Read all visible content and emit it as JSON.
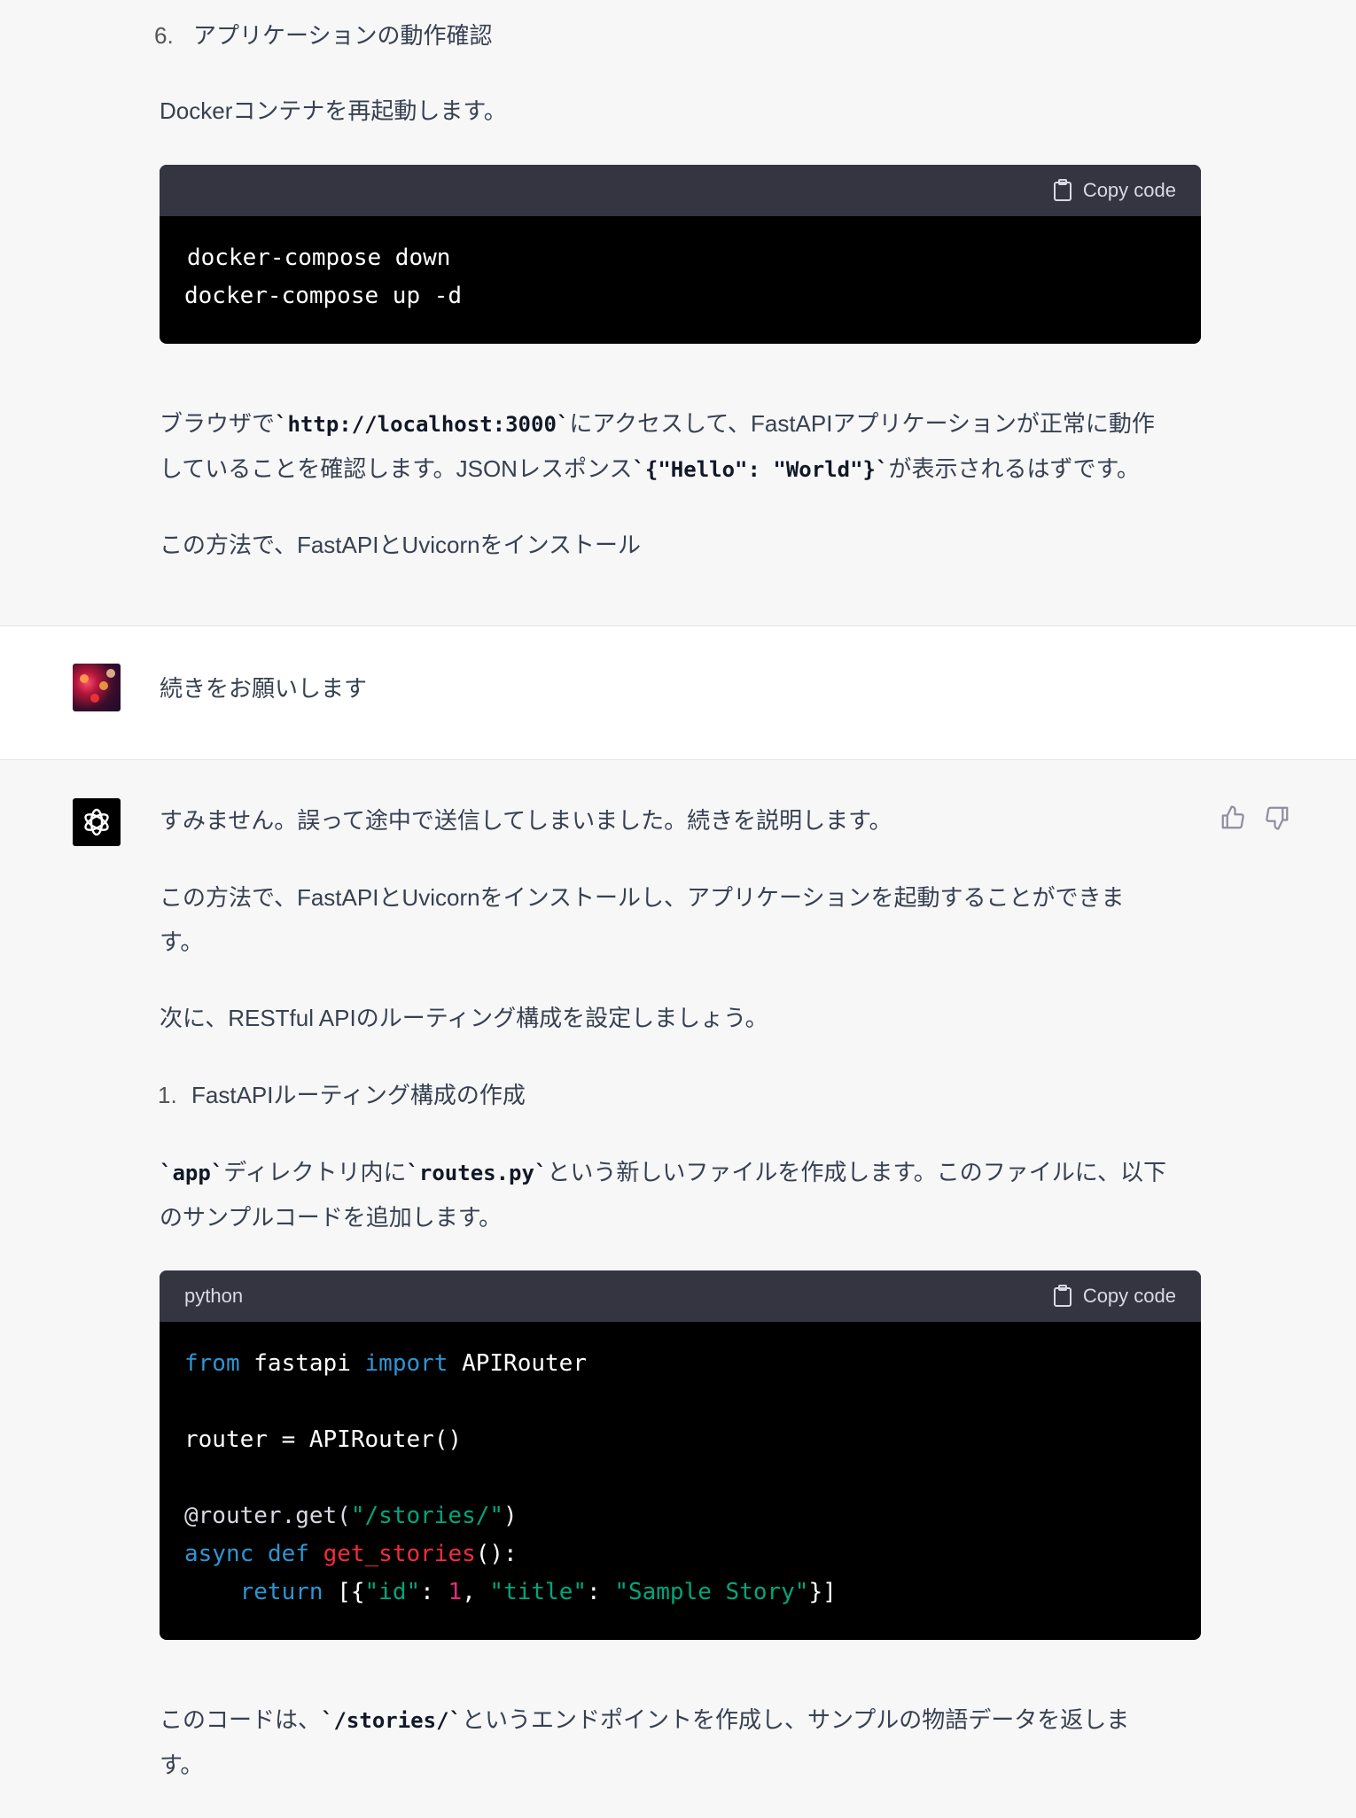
{
  "top_section": {
    "step6_number": "6.",
    "step6_label": "アプリケーションの動作確認",
    "restart_text": "Dockerコンテナを再起動します。",
    "code1": {
      "language": "",
      "copy_label": "Copy code",
      "lines": [
        "docker-compose down",
        "docker-compose up -d"
      ]
    },
    "browser_text_1a": "ブラウザで",
    "browser_code_1": "http://localhost:3000",
    "browser_text_1b": "にアクセスして、FastAPIアプリケーションが正常に動作",
    "browser_text_2a": "していることを確認します。JSONレスポンス",
    "browser_code_2": "{\"Hello\": \"World\"}",
    "browser_text_2b": "が表示されるはずです。",
    "truncated_text": "この方法で、FastAPIとUvicornをインストール"
  },
  "user_message": {
    "text": "続きをお願いします"
  },
  "assistant_message": {
    "apology": "すみません。誤って途中で送信してしまいました。続きを説明します。",
    "install_line1": "この方法で、FastAPIとUvicornをインストールし、アプリケーションを起動することができま",
    "install_line2": "す。",
    "next_text": "次に、RESTful APIのルーティング構成を設定しましょう。",
    "step1_number": "1.",
    "step1_label": "FastAPIルーティング構成の作成",
    "routes_code_app": "app",
    "routes_text_1a": "ディレクトリ内に",
    "routes_code_file": "routes.py",
    "routes_text_1b": "という新しいファイルを作成します。このファイルに、以下",
    "routes_text_2": "のサンプルコードを追加します。",
    "code2": {
      "language": "python",
      "copy_label": "Copy code"
    },
    "endpoint_text_1a": "このコードは、",
    "endpoint_code": "/stories/",
    "endpoint_text_1b": "というエンドポイントを作成し、サンプルの物語データを返しま",
    "endpoint_text_2": "す。"
  },
  "tick": "`",
  "icons": {
    "copy": "clipboard-icon",
    "thumbs_up": "thumbs-up-icon",
    "thumbs_down": "thumbs-down-icon",
    "assistant_logo": "openai-logo-icon",
    "user_avatar": "user-avatar"
  },
  "colors": {
    "keyword": "#2e95d3",
    "string": "#00a67d",
    "function": "#f22c3d",
    "number": "#df3079"
  }
}
